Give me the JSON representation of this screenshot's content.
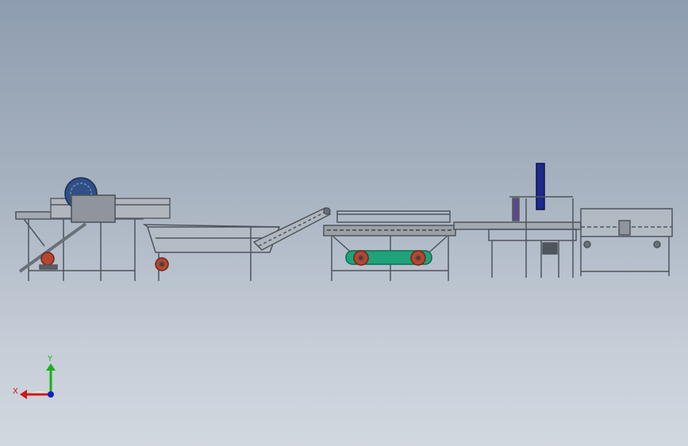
{
  "viewport": {
    "background_top": "#8e9db0",
    "background_bottom": "#d2d8df"
  },
  "model": {
    "machines": [
      "feeder-washer-with-drum",
      "soaking-tank-with-pump",
      "inclined-elevator-conveyor",
      "bubble-washer-conveyor",
      "transfer-conveyor-with-lift",
      "output-conveyor"
    ],
    "colors": {
      "frame": "#5f656c",
      "panel": "#9aa0a6",
      "drum": "#2f4f86",
      "motor": "#c0442f",
      "tank": "#1fa37a",
      "lift": "#1d2a8a"
    }
  },
  "triad": {
    "x_label": "X",
    "y_label": "Y",
    "x_color": "#d01818",
    "y_color": "#18b018",
    "z_color": "#1020c8"
  }
}
